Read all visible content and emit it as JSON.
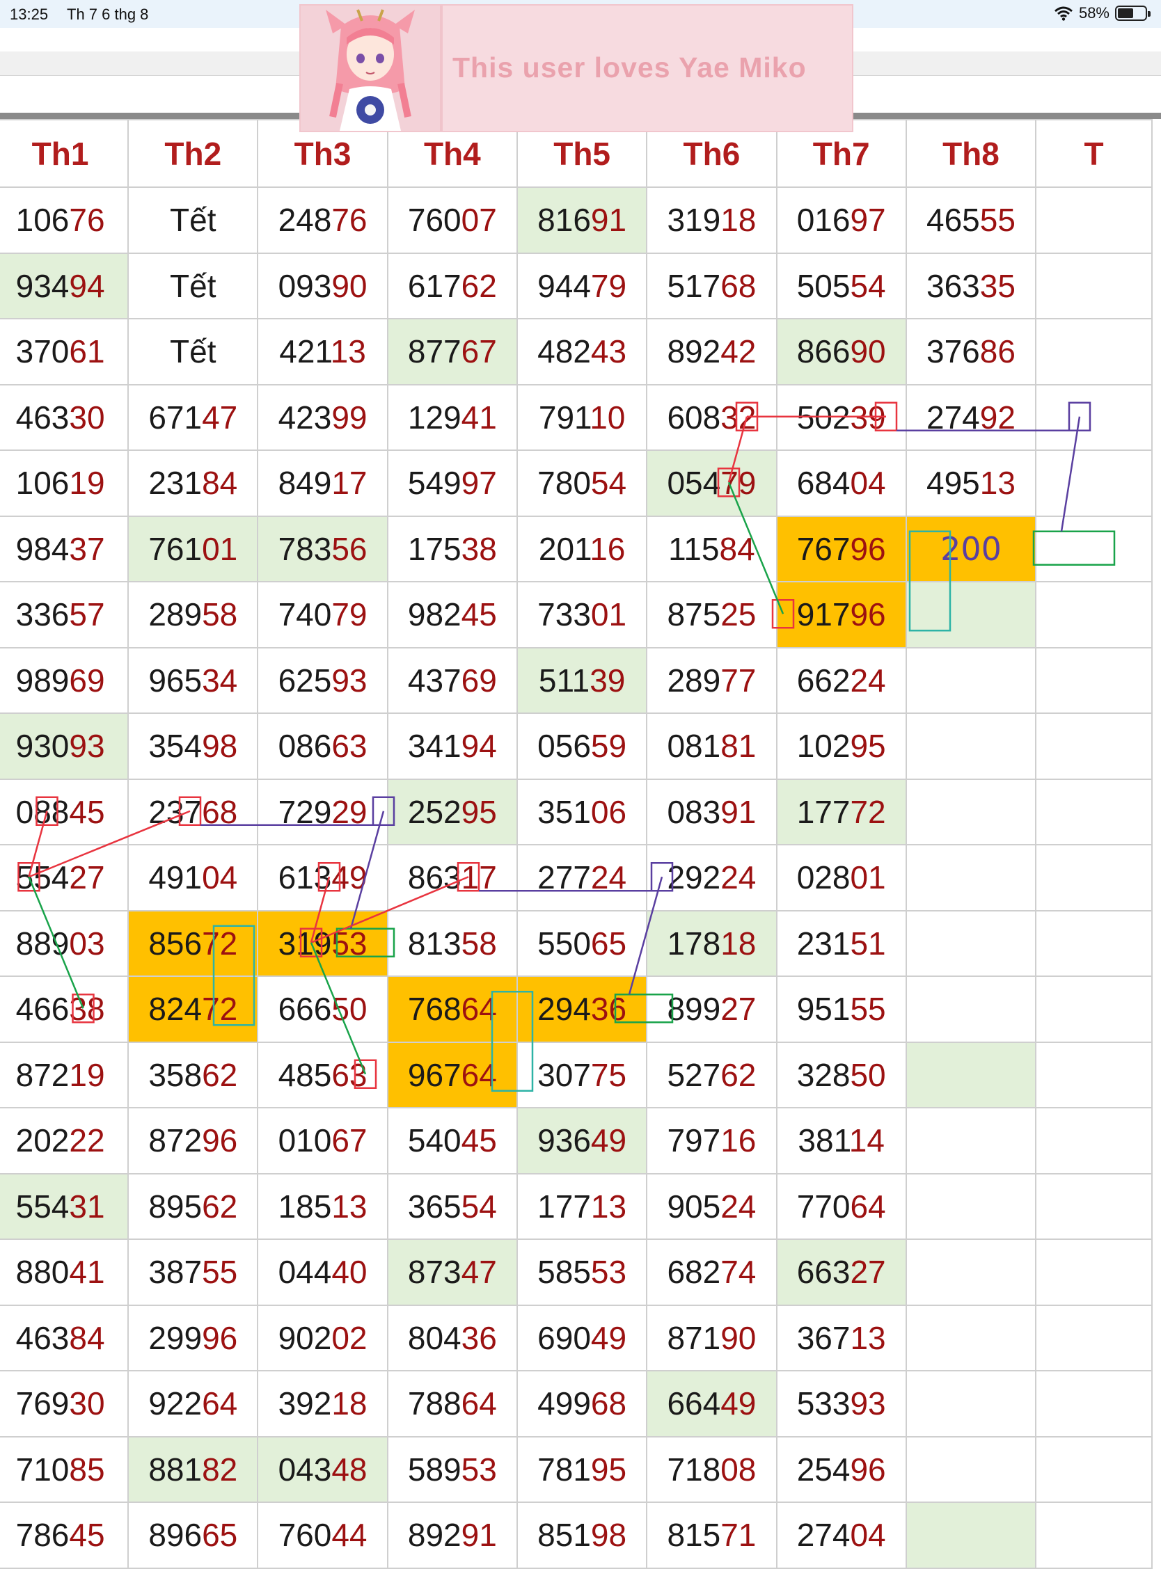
{
  "status_bar": {
    "time": "13:25",
    "date": "Th 7 6 thg 8",
    "wifi_icon": "wifi-icon",
    "battery_percent": "58%",
    "battery_level": 0.58
  },
  "banner": {
    "text": "This user loves Yae Miko",
    "avatar_icon": "anime-character-avatar"
  },
  "colors": {
    "header_text": "#b11d1d",
    "last_two_digits": "#9c1111",
    "highlight_green": "#e2f0d9",
    "highlight_orange": "#ffc000",
    "annotation_red": "#e8343f",
    "annotation_purple": "#5a3fa0",
    "annotation_green": "#19a34a",
    "annotation_teal": "#2db3a6"
  },
  "table": {
    "headers": [
      "Th1",
      "Th2",
      "Th3",
      "Th4",
      "Th5",
      "Th6",
      "Th7",
      "Th8",
      "T"
    ],
    "rows": [
      [
        "10676",
        "Tết",
        "24876",
        "76007",
        "81691",
        "31918",
        "01697",
        "46555",
        ""
      ],
      [
        "93494",
        "Tết",
        "09390",
        "61762",
        "94479",
        "51768",
        "50554",
        "36335",
        ""
      ],
      [
        "37061",
        "Tết",
        "42113",
        "87767",
        "48243",
        "89242",
        "86690",
        "37686",
        ""
      ],
      [
        "46330",
        "67147",
        "42399",
        "12941",
        "79110",
        "60832",
        "50239",
        "27492",
        ""
      ],
      [
        "10619",
        "23184",
        "84917",
        "54997",
        "78054",
        "05479",
        "68404",
        "49513",
        ""
      ],
      [
        "98437",
        "76101",
        "78356",
        "17538",
        "20116",
        "11584",
        "76796",
        "200",
        ""
      ],
      [
        "33657",
        "28958",
        "74079",
        "98245",
        "73301",
        "87525",
        "91796",
        "",
        ""
      ],
      [
        "98969",
        "96534",
        "62593",
        "43769",
        "51139",
        "28977",
        "66224",
        "",
        ""
      ],
      [
        "93093",
        "35498",
        "08663",
        "34194",
        "05659",
        "08181",
        "10295",
        "",
        ""
      ],
      [
        "08845",
        "23768",
        "72929",
        "25295",
        "35106",
        "08391",
        "17772",
        "",
        ""
      ],
      [
        "55427",
        "49104",
        "61349",
        "86317",
        "27724",
        "29224",
        "02801",
        "",
        ""
      ],
      [
        "88903",
        "85672",
        "31953",
        "81358",
        "55065",
        "17818",
        "23151",
        "",
        ""
      ],
      [
        "46638",
        "82472",
        "66650",
        "76864",
        "29436",
        "89927",
        "95155",
        "",
        ""
      ],
      [
        "87219",
        "35862",
        "48563",
        "96764",
        "30775",
        "52762",
        "32850",
        "",
        ""
      ],
      [
        "20222",
        "87296",
        "01067",
        "54045",
        "93649",
        "79716",
        "38114",
        "",
        ""
      ],
      [
        "55431",
        "89562",
        "18513",
        "36554",
        "17713",
        "90524",
        "77064",
        "",
        ""
      ],
      [
        "88041",
        "38755",
        "04440",
        "87347",
        "58553",
        "68274",
        "66327",
        "",
        ""
      ],
      [
        "46384",
        "29996",
        "90202",
        "80436",
        "69049",
        "87190",
        "36713",
        "",
        ""
      ],
      [
        "76930",
        "92264",
        "39218",
        "78864",
        "49968",
        "66449",
        "53393",
        "",
        ""
      ],
      [
        "71085",
        "88182",
        "04348",
        "58953",
        "78195",
        "71808",
        "25496",
        "",
        ""
      ],
      [
        "78645",
        "89665",
        "76044",
        "89291",
        "85198",
        "81571",
        "27404",
        "",
        ""
      ]
    ]
  }
}
